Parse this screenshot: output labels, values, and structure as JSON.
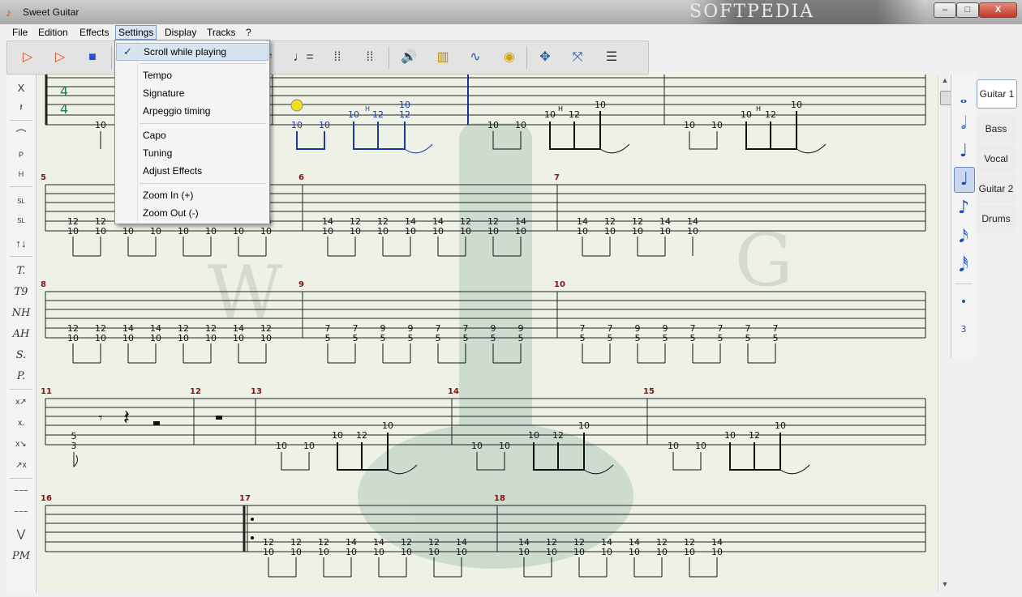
{
  "window": {
    "title": "Sweet Guitar",
    "banner": "SOFTPEDIA",
    "controls": {
      "minimize": "–",
      "maximize": "□",
      "close": "X"
    }
  },
  "menu": [
    "File",
    "Edition",
    "Effects",
    "Settings",
    "Display",
    "Tracks",
    "?"
  ],
  "settings_menu": {
    "items": [
      {
        "label": "Scroll while playing",
        "checked": true
      },
      {
        "label": "Tempo"
      },
      {
        "label": "Signature"
      },
      {
        "label": "Arpeggio timing"
      },
      {
        "label": "Capo"
      },
      {
        "label": "Tuning"
      },
      {
        "label": "Adjust Effects"
      },
      {
        "label": "Zoom In (+)"
      },
      {
        "label": "Zoom Out (-)"
      }
    ]
  },
  "toolbar_icons": [
    "play-icon",
    "play-from-cursor-icon",
    "stop-icon",
    "note-value-icon",
    "tempo-icon",
    "loop-start-icon",
    "loop-end-icon",
    "volume-icon",
    "mixer-icon",
    "sine-wave-icon",
    "tuner-icon",
    "move-icon",
    "resize-icon",
    "lines-icon"
  ],
  "left_tools": [
    "X",
    "𝄽",
    "⌒",
    "P",
    "H",
    "SL",
    "SL",
    "↑↓",
    "T.",
    "T9",
    "NH",
    "AH",
    "S.",
    "P.",
    "x↗",
    "x.",
    "x↘",
    "↗x",
    "~~~",
    "~~~",
    "⋁",
    "PM"
  ],
  "note_values": [
    "𝅝",
    "𝅗𝅥",
    "♩",
    "♩",
    "♪",
    "𝅘𝅥𝅯",
    "𝅘𝅥𝅰",
    "•",
    "3"
  ],
  "tracks": [
    "Guitar 1",
    "Bass",
    "Vocal",
    "Guitar 2",
    "Drums"
  ],
  "score": {
    "time_signature": [
      "4",
      "4"
    ],
    "measure_numbers": [
      "5",
      "6",
      "7",
      "8",
      "9",
      "10",
      "11",
      "12",
      "13",
      "14",
      "15",
      "16",
      "17",
      "18"
    ],
    "rows": [
      {
        "notes": [
          "10",
          "10",
          "10",
          "10",
          "10",
          "12",
          "10",
          "12",
          "10",
          "10",
          "10",
          "12",
          "10",
          "10",
          "10",
          "12",
          "10"
        ]
      },
      {
        "notes": [
          "12",
          "10",
          "12",
          "10",
          "12",
          "10",
          "12",
          "10",
          "12",
          "10",
          "12",
          "10",
          "12",
          "10",
          "14",
          "10",
          "14",
          "10",
          "12",
          "10",
          "12",
          "10",
          "14",
          "10",
          "14",
          "10",
          "12",
          "10",
          "12",
          "10",
          "14",
          "10",
          "14",
          "10",
          "12",
          "10",
          "12",
          "10",
          "14",
          "10",
          "14",
          "10"
        ]
      },
      {
        "notes": [
          "12",
          "10",
          "12",
          "10",
          "14",
          "10",
          "14",
          "10",
          "12",
          "10",
          "12",
          "10",
          "14",
          "10",
          "12",
          "10",
          "7",
          "5",
          "7",
          "5",
          "9",
          "5",
          "9",
          "5",
          "7",
          "5",
          "7",
          "5",
          "9",
          "5",
          "9",
          "5",
          "7",
          "5",
          "7",
          "5",
          "9",
          "5",
          "9",
          "5",
          "7",
          "5",
          "7",
          "5",
          "7",
          "5",
          "7",
          "5",
          "5",
          "3"
        ]
      },
      {
        "notes": [
          "5",
          "3",
          "10",
          "10",
          "10",
          "12",
          "10",
          "10",
          "10",
          "10",
          "12",
          "10",
          "10",
          "10",
          "10",
          "12",
          "10"
        ]
      },
      {
        "notes": [
          "10",
          "10",
          "10",
          "12",
          "10",
          "12",
          "10",
          "12",
          "10",
          "14",
          "10",
          "14",
          "10",
          "12",
          "10",
          "12",
          "10",
          "14",
          "10",
          "14",
          "10",
          "12",
          "10",
          "12",
          "10",
          "14",
          "10",
          "14",
          "10",
          "12",
          "10",
          "12",
          "10",
          "14",
          "10",
          "14",
          "10"
        ]
      }
    ],
    "hammer_label": "H"
  }
}
